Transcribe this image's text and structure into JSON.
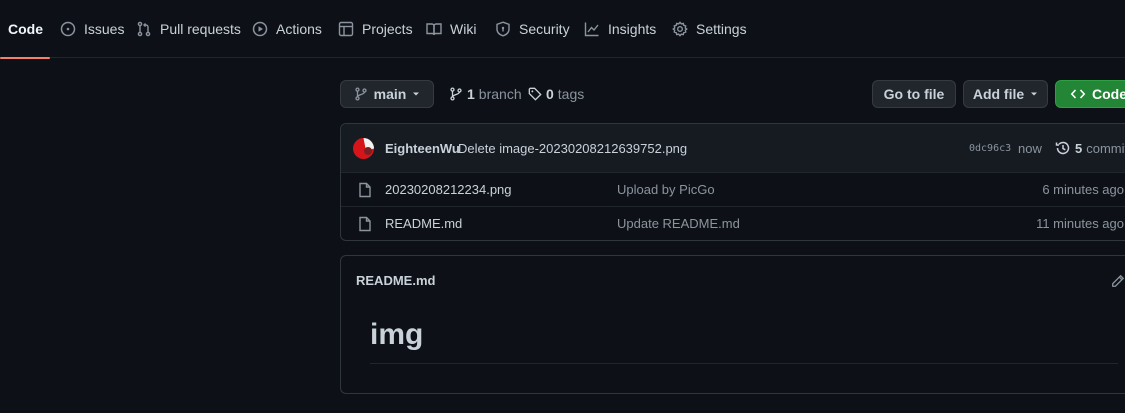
{
  "nav": {
    "tabs": [
      {
        "label": "Code",
        "icon": "code-icon"
      },
      {
        "label": "Issues",
        "icon": "issue-circle-icon"
      },
      {
        "label": "Pull requests",
        "icon": "pull-request-icon"
      },
      {
        "label": "Actions",
        "icon": "play-circle-icon"
      },
      {
        "label": "Projects",
        "icon": "table-icon"
      },
      {
        "label": "Wiki",
        "icon": "book-icon"
      },
      {
        "label": "Security",
        "icon": "shield-icon"
      },
      {
        "label": "Insights",
        "icon": "graph-icon"
      },
      {
        "label": "Settings",
        "icon": "gear-icon"
      }
    ],
    "active": "Code"
  },
  "toolbar": {
    "branch_name": "main",
    "branch_count": "1",
    "branch_label": "branch",
    "tag_count": "0",
    "tag_label": "tags",
    "go_to_file": "Go to file",
    "add_file": "Add file",
    "code": "Code"
  },
  "commit": {
    "author": "EighteenWu",
    "message": "Delete image-20230208212639752.png",
    "sha": "0dc96c3",
    "time": "now",
    "commits_count": "5",
    "commits_label": "commits"
  },
  "files": [
    {
      "name": "20230208212234.png",
      "message": "Upload by PicGo",
      "time": "6 minutes ago"
    },
    {
      "name": "README.md",
      "message": "Update README.md",
      "time": "11 minutes ago"
    }
  ],
  "readme": {
    "title": "README.md",
    "heading": "img"
  },
  "colors": {
    "background": "#0d1117",
    "accent_underline": "#f78166",
    "green_button": "#238636"
  }
}
